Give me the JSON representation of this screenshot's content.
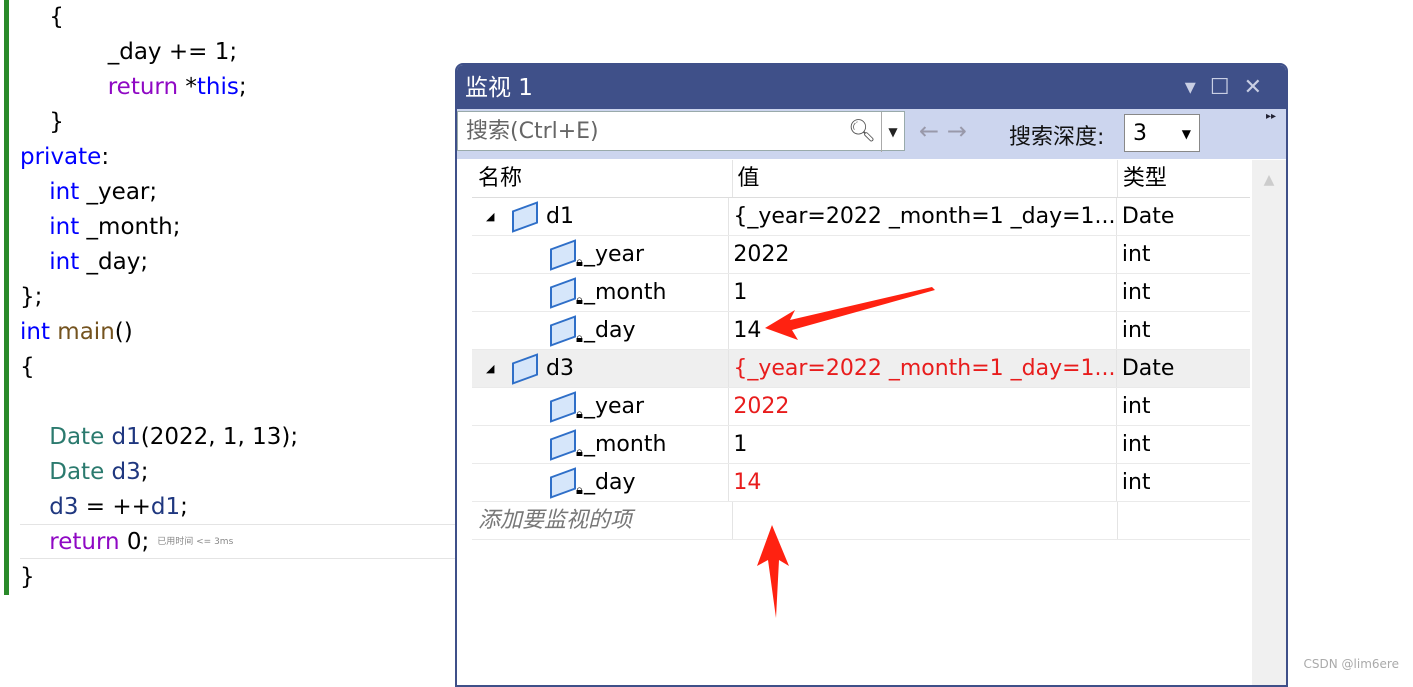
{
  "code": {
    "lines": [
      {
        "indent": "  ",
        "parts": [
          [
            "",
            "{"
          ]
        ]
      },
      {
        "indent": "      ",
        "parts": [
          [
            "",
            "_day += 1;"
          ]
        ]
      },
      {
        "indent": "      ",
        "parts": [
          [
            "pur",
            "return"
          ],
          [
            "",
            " *"
          ],
          [
            "kw",
            "this"
          ],
          [
            "",
            ";"
          ]
        ]
      },
      {
        "indent": "  ",
        "parts": [
          [
            "",
            "}"
          ]
        ]
      },
      {
        "indent": "",
        "parts": [
          [
            "kw",
            "private"
          ],
          [
            "",
            ":"
          ]
        ]
      },
      {
        "indent": "  ",
        "parts": [
          [
            "kw",
            "int"
          ],
          [
            "",
            " _year;"
          ]
        ]
      },
      {
        "indent": "  ",
        "parts": [
          [
            "kw",
            "int"
          ],
          [
            "",
            " _month;"
          ]
        ]
      },
      {
        "indent": "  ",
        "parts": [
          [
            "kw",
            "int"
          ],
          [
            "",
            " _day;"
          ]
        ]
      },
      {
        "indent": "",
        "parts": [
          [
            "",
            "};"
          ]
        ]
      },
      {
        "indent": "",
        "parts": [
          [
            "kw",
            "int"
          ],
          [
            "fn",
            " main"
          ],
          [
            "",
            "()"
          ]
        ]
      },
      {
        "indent": "",
        "parts": [
          [
            "",
            "{"
          ]
        ]
      },
      {
        "indent": "",
        "parts": []
      },
      {
        "indent": "  ",
        "parts": [
          [
            "ty",
            "Date"
          ],
          [
            "var",
            " d1"
          ],
          [
            "",
            "(2022, 1, 13);"
          ]
        ]
      },
      {
        "indent": "  ",
        "parts": [
          [
            "ty",
            "Date"
          ],
          [
            "var",
            " d3"
          ],
          [
            "",
            ";"
          ]
        ]
      },
      {
        "indent": "  ",
        "parts": [
          [
            "var",
            "d3"
          ],
          [
            "",
            " = ++"
          ],
          [
            "var",
            "d1"
          ],
          [
            "",
            ";"
          ]
        ]
      },
      {
        "indent": "  ",
        "parts": [
          [
            "pur",
            "return"
          ],
          [
            "",
            " 0;"
          ]
        ]
      },
      {
        "indent": "",
        "parts": [
          [
            "",
            "}"
          ]
        ]
      }
    ],
    "elapsed_hint": "已用时间 <= 3ms"
  },
  "watch": {
    "title": "监视 1",
    "search_placeholder": "搜索(Ctrl+E)",
    "depth_label": "搜索深度:",
    "depth_value": "3",
    "columns": [
      "名称",
      "值",
      "类型"
    ],
    "rows": [
      {
        "name": "d1",
        "value": "{_year=2022 _month=1 _day=1...",
        "type": "Date",
        "level": 0,
        "expanded": true,
        "changed": false
      },
      {
        "name": "_year",
        "value": "2022",
        "type": "int",
        "level": 1,
        "changed": false
      },
      {
        "name": "_month",
        "value": "1",
        "type": "int",
        "level": 1,
        "changed": false
      },
      {
        "name": "_day",
        "value": "14",
        "type": "int",
        "level": 1,
        "changed": false
      },
      {
        "name": "d3",
        "value": "{_year=2022 _month=1 _day=1...",
        "type": "Date",
        "level": 0,
        "expanded": true,
        "changed": true,
        "selected": true
      },
      {
        "name": "_year",
        "value": "2022",
        "type": "int",
        "level": 1,
        "changed": true
      },
      {
        "name": "_month",
        "value": "1",
        "type": "int",
        "level": 1,
        "changed": false
      },
      {
        "name": "_day",
        "value": "14",
        "type": "int",
        "level": 1,
        "changed": true
      }
    ],
    "add_item_placeholder": "添加要监视的项"
  },
  "watermark": "CSDN @lim6ere",
  "colors": {
    "title_bar": "#3f5089",
    "changed_value": "#e81c1c",
    "annotation_arrow": "#ff2211"
  }
}
